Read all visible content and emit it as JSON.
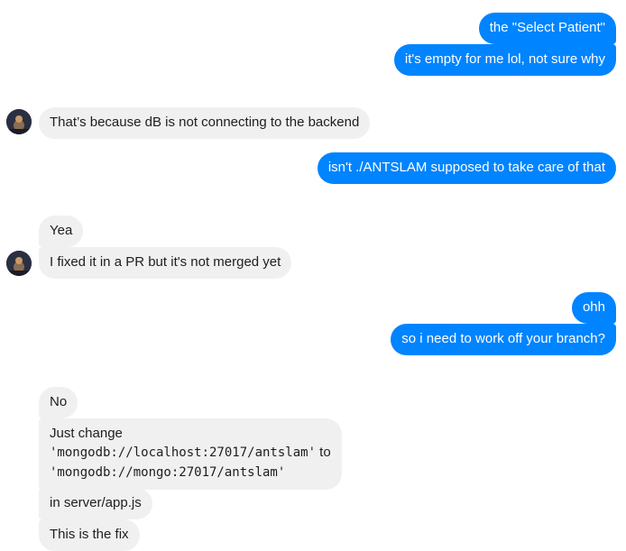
{
  "messages": {
    "m1": "the \"Select Patient\"",
    "m2": "it's empty for me lol, not sure why",
    "m3": "That’s because dB is not connecting to the backend",
    "m4": "isn't ./ANTSLAM supposed to take care of that",
    "m5": "Yea",
    "m6": "I fixed it in a PR but it's not merged yet",
    "m7": "ohh",
    "m8": "so i need to work off your branch?",
    "m9": "No",
    "m10": {
      "line1": "Just change",
      "code1": "'mongodb://localhost:27017/antslam'",
      "to_word": " to",
      "code2": "'mongodb://mongo:27017/antslam'"
    },
    "m11": "in server/app.js",
    "m12": "This is the fix"
  },
  "colors": {
    "sent_bubble": "#0084ff",
    "received_bubble": "#f1f0f0"
  },
  "icons": {
    "avatar": "contact-avatar"
  }
}
